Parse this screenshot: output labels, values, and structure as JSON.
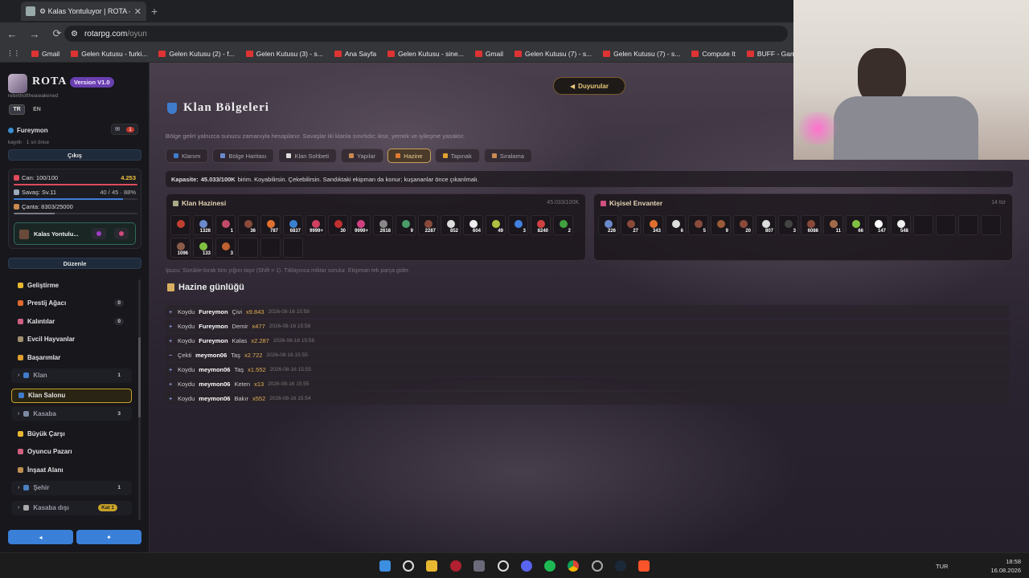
{
  "browser": {
    "tab_title": "⚙ Kalas Yontuluyor | ROTA —",
    "url_host": "rotarpg.com",
    "url_path": "/oyun",
    "bookmarks": [
      "Gmail",
      "Gelen Kutusu - furki...",
      "Gelen Kutusu (2) - f...",
      "Gelen Kutusu (3) - s...",
      "Ana Sayfa",
      "Gelen Kutusu - sine...",
      "Gmail",
      "Gelen Kutusu (7) - s...",
      "Gelen Kutusu (7) - s...",
      "Compute It",
      "BUFF - Game for Fu..."
    ]
  },
  "sidebar": {
    "brand": "ROTA",
    "version": "Version V1.0",
    "slogan": "rebirthoftheawakened",
    "lang_tr": "TR",
    "lang_en": "EN",
    "username": "Fureymon",
    "mail_count": "1",
    "save_status": "kayıtlı · 1 sn önce",
    "logout": "Çıkış",
    "hp_label": "Can: 100/100",
    "gold": "4.253",
    "war_label": "Savaş: Sv.11",
    "war_progress": "40 / 45 · 88%",
    "war_fraction": 0.88,
    "bag_label": "Çanta: 8303/25000",
    "bag_fraction": 0.33,
    "task": "Kalas Yontulu...",
    "edit": "Düzenle",
    "menu": [
      {
        "label": "Geliştirme",
        "count": "",
        "type": "item"
      },
      {
        "label": "Prestij Ağacı",
        "count": "0",
        "type": "item"
      },
      {
        "label": "Kalıntılar",
        "count": "0",
        "type": "item"
      },
      {
        "label": "Evcil Hayvanlar",
        "count": "",
        "type": "item"
      },
      {
        "label": "Başarımlar",
        "count": "",
        "type": "item"
      },
      {
        "label": "Klan",
        "count": "1",
        "type": "group"
      },
      {
        "label": "Klan Salonu",
        "count": "",
        "type": "active"
      },
      {
        "label": "Kasaba",
        "count": "3",
        "type": "group"
      },
      {
        "label": "Büyük Çarşı",
        "count": "",
        "type": "item"
      },
      {
        "label": "Oyuncu Pazarı",
        "count": "",
        "type": "item"
      },
      {
        "label": "İnşaat Alanı",
        "count": "",
        "type": "item"
      },
      {
        "label": "Şehir",
        "count": "1",
        "type": "group"
      },
      {
        "label": "Kasaba dışı",
        "count": "Kat 1",
        "type": "group"
      }
    ]
  },
  "main": {
    "announce": "Duyurular",
    "title": "Klan Bölgeleri",
    "subtitle": "Bölge gelirI yalnızca sunucu zamanıyla hesaplanır. Savaşlar iki klanla sınırlıdır; iksir, yemek ve iyileşme yasaktır.",
    "tabs": [
      "Klanım",
      "Bölge Haritası",
      "Klan Sohbeti",
      "Yapılar",
      "Hazine",
      "Tapınak",
      "Sıralama"
    ],
    "capacity_label": "Kapasite:",
    "capacity_value": "45.033/100K",
    "capacity_text": "birim. Koyabilirsin. Çekebilirsin. Sandıktaki ekipman da konur; kuşananlar önce çıkarılmalı.",
    "clan_title": "Klan Hazinesi",
    "clan_cap": "45.033/100K",
    "clan_items": [
      "",
      "1326",
      "1",
      "36",
      "787",
      "6837",
      "9999+",
      "30",
      "9999+",
      "2618",
      "9",
      "2287",
      "852",
      "604",
      "49",
      "3",
      "8240",
      "2",
      "1096",
      "133",
      "3"
    ],
    "clan_colors": [
      "#c04030",
      "#6a8acc",
      "#c04a6a",
      "#8a4a3a",
      "#e07030",
      "#3a80d0",
      "#d04060",
      "#c03030",
      "#d04080",
      "#888",
      "#4a9a6a",
      "#8a4a3a",
      "#ddd",
      "#eee",
      "#b0c040",
      "#4080e0",
      "#d04040",
      "#40a040",
      "#8a5a4a",
      "#80c040",
      "#c06030"
    ],
    "inv_title": "Kişisel Envanter",
    "inv_count": "14 tür",
    "inv_items": [
      "226",
      "27",
      "343",
      "6",
      "5",
      "9",
      "20",
      "807",
      "3",
      "6086",
      "11",
      "66",
      "147",
      "548"
    ],
    "inv_colors": [
      "#6a8acc",
      "#8a4a3a",
      "#e07030",
      "#ddd",
      "#8a4a3a",
      "#9a5a3a",
      "#8a4a3a",
      "#ddd",
      "#444",
      "#8a4a3a",
      "#a06a4a",
      "#80c040",
      "#fff",
      "#eee"
    ],
    "tip": "İpucu: Sürükle-bırak tüm yığını taşır (Shift = 1). Tıklayınca miktar sorulur. Ekipman tek parça gider.",
    "log_title": "Hazine günlüğü",
    "logs": [
      {
        "sign": "+",
        "action": "Koydu",
        "who": "Fureymon",
        "item": "Çivi",
        "amount": "x9.843",
        "time": "2026-08-16 15:58"
      },
      {
        "sign": "+",
        "action": "Koydu",
        "who": "Fureymon",
        "item": "Demir",
        "amount": "x477",
        "time": "2026-08-16 15:58"
      },
      {
        "sign": "+",
        "action": "Koydu",
        "who": "Fureymon",
        "item": "Kalas",
        "amount": "x2.287",
        "time": "2026-08-16 15:58"
      },
      {
        "sign": "−",
        "action": "Çekti",
        "who": "meymon06",
        "item": "Taş",
        "amount": "x2.722",
        "time": "2026-08-16 15:55"
      },
      {
        "sign": "+",
        "action": "Koydu",
        "who": "meymon06",
        "item": "Taş",
        "amount": "x1.552",
        "time": "2026-08-16 15:55"
      },
      {
        "sign": "+",
        "action": "Koydu",
        "who": "meymon06",
        "item": "Keten",
        "amount": "x13",
        "time": "2026-08-16 15:55"
      },
      {
        "sign": "+",
        "action": "Koydu",
        "who": "meymon06",
        "item": "Bakır",
        "amount": "x552",
        "time": "2026-08-16 15:54"
      }
    ]
  },
  "taskbar": {
    "lang": "TUR",
    "time": "18:58",
    "date": "16.08.2026"
  }
}
